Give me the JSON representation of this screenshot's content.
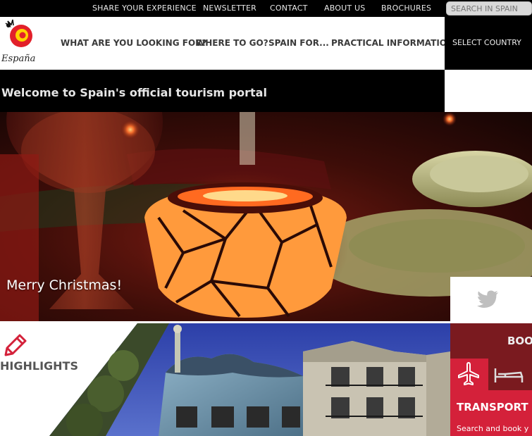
{
  "topbar": {
    "links": [
      "SHARE YOUR EXPERIENCE",
      "NEWSLETTER",
      "CONTACT",
      "ABOUT US",
      "BROCHURES"
    ],
    "search_placeholder": "SEARCH IN SPAIN"
  },
  "logo": {
    "wordmark": "España"
  },
  "nav": {
    "items": [
      "WHAT ARE YOU LOOKING FOR?",
      "WHERE TO GO?",
      "SPAIN FOR...",
      "PRACTICAL INFORMATION"
    ],
    "country_selector": "SELECT COUNTRY"
  },
  "welcome": {
    "text": "Welcome to Spain's official tourism portal"
  },
  "hero": {
    "caption": "Merry Christmas!"
  },
  "highlights": {
    "title": "HIGHLIGHTS"
  },
  "booking": {
    "title": "BOO",
    "transport_title": "TRANSPORT",
    "transport_subtitle": "Search and book y"
  },
  "icons": {
    "twitter": "twitter-bird-icon",
    "pencil": "pencil-icon",
    "plane": "plane-icon",
    "bed": "bed-icon"
  },
  "colors": {
    "accent_red": "#d4213a",
    "dark_red": "#7a1a1f",
    "header_black": "#000000"
  }
}
